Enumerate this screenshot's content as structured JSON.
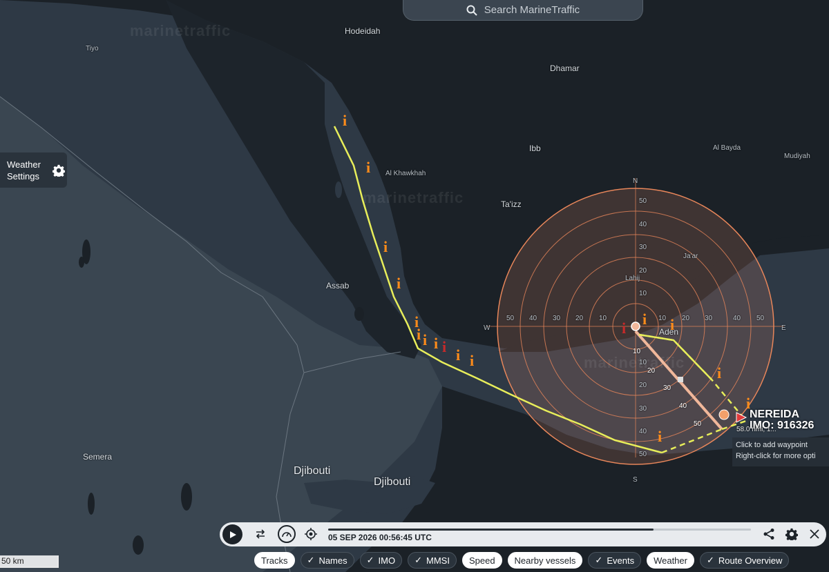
{
  "search": {
    "placeholder": "Search MarineTraffic"
  },
  "brand": "marinetraffic",
  "weather_panel": {
    "label_line1": "Weather",
    "label_line2": "Settings"
  },
  "places": {
    "hodeidah": "Hodeidah",
    "tiyo": "Tiyo",
    "dhamar": "Dhamar",
    "ibb": "Ibb",
    "al_bayda": "Al Bayda",
    "mudiyah": "Mudiyah",
    "al_khawkhah": "Al Khawkhah",
    "taizz": "Ta'izz",
    "jaar": "Ja'ar",
    "lahij": "Lahij",
    "assab": "Assab",
    "aden": "Aden",
    "semera": "Semera",
    "djibouti_country": "Djibouti",
    "djibouti_city": "Djibouti"
  },
  "compass": {
    "n": "N",
    "s": "S",
    "e": "E",
    "w": "W"
  },
  "range_rings": [
    "10",
    "20",
    "30",
    "40",
    "50"
  ],
  "bearing_ticks": [
    "10",
    "20",
    "30",
    "40",
    "50"
  ],
  "vessel": {
    "name": "NEREIDA",
    "imo": "IMO: 916326",
    "distance": "58.0 nmi, 1..."
  },
  "tooltip": {
    "line1": "Click to add waypoint",
    "line2": "Right-click for more opti"
  },
  "playback": {
    "timestamp": "05 SEP 2026 00:56:45 UTC",
    "progress": 0.77
  },
  "chips": [
    {
      "label": "Tracks",
      "checked": false,
      "style": "on"
    },
    {
      "label": "Names",
      "checked": true,
      "style": "off"
    },
    {
      "label": "IMO",
      "checked": true,
      "style": "off"
    },
    {
      "label": "MMSI",
      "checked": true,
      "style": "off"
    },
    {
      "label": "Speed",
      "checked": false,
      "style": "on"
    },
    {
      "label": "Nearby vessels",
      "checked": false,
      "style": "on"
    },
    {
      "label": "Events",
      "checked": true,
      "style": "off"
    },
    {
      "label": "Weather",
      "checked": false,
      "style": "on"
    },
    {
      "label": "Route Overview",
      "checked": true,
      "style": "off"
    }
  ],
  "scale": "50 km",
  "colors": {
    "track": "#e8ee5a",
    "event_icon": "#ff8c1a",
    "radar_ring": "#e8865a",
    "land": "#1b2127",
    "sea": "#2b3640"
  }
}
